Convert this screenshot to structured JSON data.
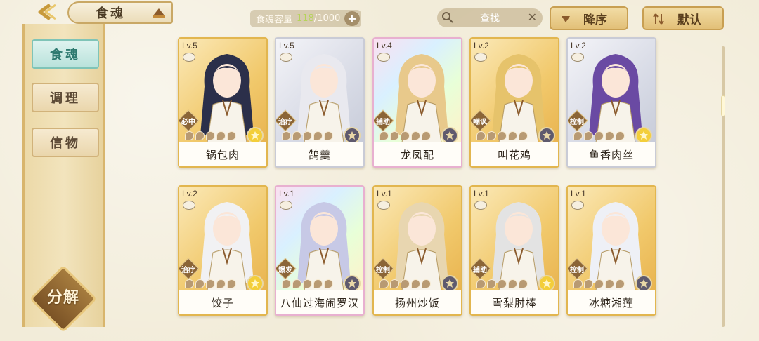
{
  "header": {
    "title": "食魂",
    "capacity_label": "食魂容量",
    "capacity_used": "118",
    "capacity_total": "/1000",
    "search_placeholder": "查找",
    "sort_label": "降序",
    "default_label": "默认",
    "icons": [
      "back-arrow-icon",
      "hat-icon",
      "plus-icon",
      "search-icon",
      "close-icon",
      "sort-triangle-icon",
      "default-sort-icon"
    ]
  },
  "sidebar": {
    "tabs": [
      {
        "label": "食魂",
        "active": true
      },
      {
        "label": "调理",
        "active": false
      },
      {
        "label": "信物",
        "active": false
      }
    ],
    "decompose_label": "分解"
  },
  "cards": [
    {
      "level": "Lv.5",
      "name": "锅包肉",
      "role": "必中",
      "stars": 0,
      "element": "gold",
      "frame": "gold",
      "hair": "#2b2f4a"
    },
    {
      "level": "Lv.5",
      "name": "鹄羹",
      "role": "治疗",
      "stars": 0,
      "element": "dark",
      "frame": "silver",
      "hair": "#e9e9ef"
    },
    {
      "level": "Lv.4",
      "name": "龙凤配",
      "role": "辅助",
      "stars": 0,
      "element": "dark",
      "frame": "rainbow",
      "hair": "#e8c98b"
    },
    {
      "level": "Lv.2",
      "name": "叫花鸡",
      "role": "嘲讽",
      "stars": 0,
      "element": "dark",
      "frame": "gold",
      "hair": "#e6c36b"
    },
    {
      "level": "Lv.2",
      "name": "鱼香肉丝",
      "role": "控制",
      "stars": 0,
      "element": "gold",
      "frame": "silver",
      "hair": "#6a4aa3"
    },
    {
      "level": "Lv.2",
      "name": "饺子",
      "role": "治疗",
      "stars": 0,
      "element": "gold",
      "frame": "gold",
      "hair": "#f1f1f3"
    },
    {
      "level": "Lv.1",
      "name": "八仙过海闹罗汉",
      "role": "爆发",
      "stars": 0,
      "element": "dark",
      "frame": "rainbow",
      "hair": "#c7c9e6"
    },
    {
      "level": "Lv.1",
      "name": "扬州炒饭",
      "role": "控制",
      "stars": 0,
      "element": "dark",
      "frame": "gold",
      "hair": "#e8d6b0"
    },
    {
      "level": "Lv.1",
      "name": "雪梨肘棒",
      "role": "辅助",
      "stars": 0,
      "element": "gold",
      "frame": "gold",
      "hair": "#e3e3e3"
    },
    {
      "level": "Lv.1",
      "name": "冰糖湘莲",
      "role": "控制",
      "stars": 0,
      "element": "dark",
      "frame": "gold",
      "hair": "#eef0f6"
    }
  ],
  "colors": {
    "accent_teal": "#7fc4b7",
    "gold_frame": "#e2b64f",
    "capacity_used": "#b6d35a"
  }
}
